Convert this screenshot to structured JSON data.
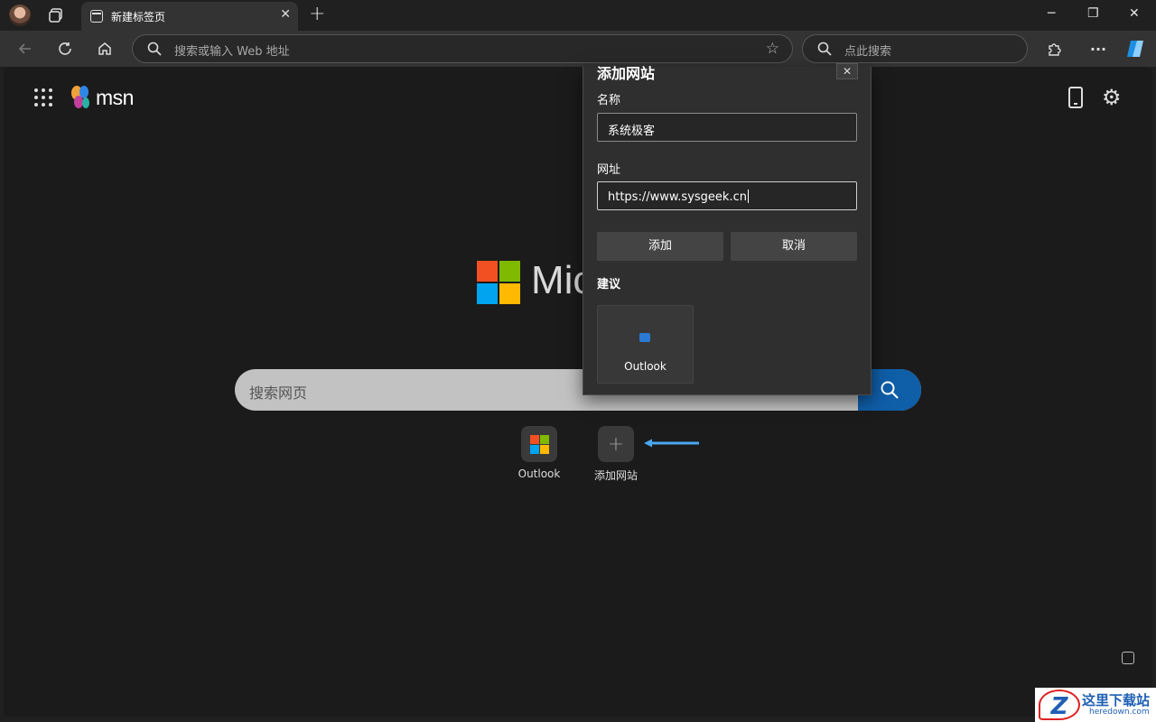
{
  "browser": {
    "tab_title": "新建标签页",
    "tab_close": "✕",
    "new_tab": "+",
    "window_controls": [
      "─",
      "❐",
      "✕"
    ],
    "address_placeholder": "搜索或输入 Web 地址",
    "side_search_placeholder": "点此搜索",
    "more_menu": "···"
  },
  "page": {
    "brand": "msn",
    "ms_word": "Mic",
    "search_placeholder": "搜索网页",
    "quick_links": [
      {
        "label": "Outlook"
      },
      {
        "label": "添加网站"
      }
    ],
    "ms_logo_colors": [
      "#f25022",
      "#7fba00",
      "#00a4ef",
      "#ffb900"
    ]
  },
  "dialog": {
    "title": "添加网站",
    "close": "✕",
    "name_label": "名称",
    "name_value": "系统极客",
    "url_label": "网址",
    "url_value": "https://www.sysgeek.cn",
    "add_button": "添加",
    "cancel_button": "取消",
    "suggestions_title": "建议",
    "suggestions": [
      {
        "label": "Outlook"
      }
    ]
  },
  "watermark": {
    "cn": "这里下载站",
    "en": "heredown.com"
  }
}
